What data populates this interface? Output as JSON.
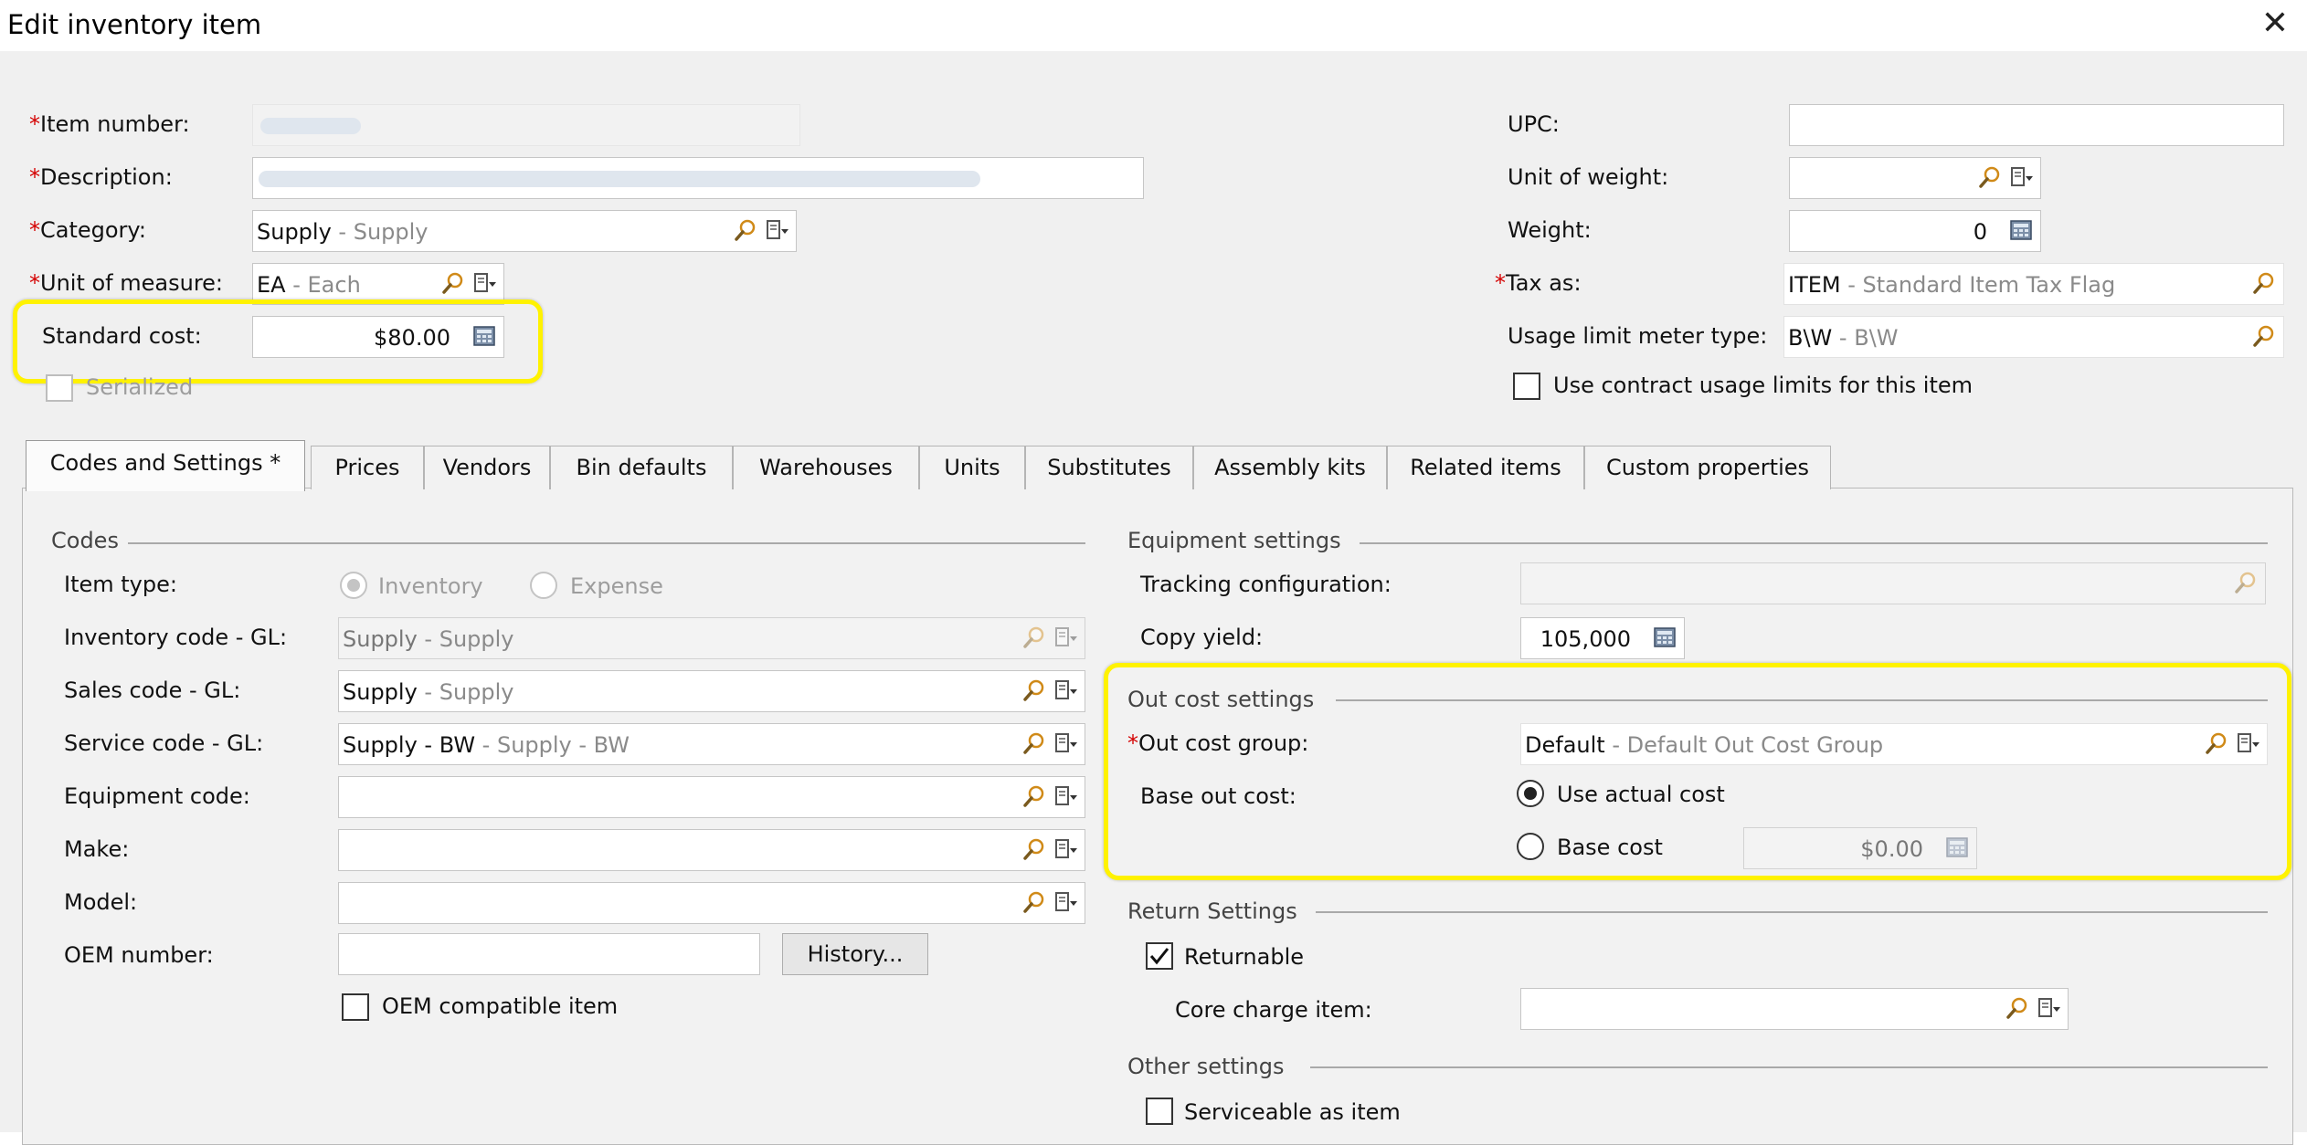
{
  "window": {
    "title": "Edit inventory item",
    "close": "✕"
  },
  "form": {
    "item_number": {
      "label": "Item number:",
      "required": "*"
    },
    "description": {
      "label": "Description:",
      "required": "*"
    },
    "category": {
      "label": "Category:",
      "required": "*",
      "code": "Supply",
      "desc": " - Supply"
    },
    "unit_of_measure": {
      "label": "Unit of measure:",
      "required": "*",
      "code": "EA",
      "desc": " - Each"
    },
    "standard_cost": {
      "label": "Standard cost:",
      "value": "$80.00"
    },
    "serialized": {
      "label": "Serialized",
      "checked": false
    },
    "upc": {
      "label": "UPC:",
      "value": ""
    },
    "unit_of_weight": {
      "label": "Unit of weight:",
      "value": ""
    },
    "weight": {
      "label": "Weight:",
      "value": "0"
    },
    "tax_as": {
      "label": "Tax as:",
      "required": "*",
      "code": "ITEM",
      "desc": " - Standard Item Tax Flag"
    },
    "usage_limit_meter_type": {
      "label": "Usage limit meter type:",
      "code": "B\\W",
      "desc": " - B\\W"
    },
    "use_contract_usage": {
      "label": "Use contract usage limits for this item",
      "checked": false
    }
  },
  "tabs": [
    {
      "label": "Codes and Settings  *",
      "active": true
    },
    {
      "label": "Prices"
    },
    {
      "label": "Vendors"
    },
    {
      "label": "Bin defaults"
    },
    {
      "label": "Warehouses"
    },
    {
      "label": "Units"
    },
    {
      "label": "Substitutes"
    },
    {
      "label": "Assembly kits"
    },
    {
      "label": "Related items"
    },
    {
      "label": "Custom properties"
    }
  ],
  "codes": {
    "title": "Codes",
    "item_type": {
      "label": "Item type:",
      "options": [
        "Inventory",
        "Expense"
      ],
      "selected": "Inventory"
    },
    "inventory_code": {
      "label": "Inventory code - GL:",
      "code": "Supply",
      "desc": " - Supply"
    },
    "sales_code": {
      "label": "Sales code - GL:",
      "code": "Supply",
      "desc": " - Supply"
    },
    "service_code": {
      "label": "Service code - GL:",
      "code": "Supply - BW",
      "desc": " - Supply - BW"
    },
    "equipment_code": {
      "label": "Equipment code:",
      "value": ""
    },
    "make": {
      "label": "Make:",
      "value": ""
    },
    "model": {
      "label": "Model:",
      "value": ""
    },
    "oem_number": {
      "label": "OEM number:",
      "value": "",
      "history_button": "History..."
    },
    "oem_compatible": {
      "label": "OEM compatible item",
      "checked": false
    }
  },
  "equipment_settings": {
    "title": "Equipment settings",
    "tracking_configuration": {
      "label": "Tracking configuration:",
      "value": ""
    },
    "copy_yield": {
      "label": "Copy yield:",
      "value": "105,000"
    }
  },
  "out_cost_settings": {
    "title": "Out cost settings",
    "out_cost_group": {
      "label": "Out cost group:",
      "required": "*",
      "code": "Default",
      "desc": " - Default Out Cost Group"
    },
    "base_out_cost": {
      "label": "Base out cost:",
      "options": [
        "Use actual cost",
        "Base cost"
      ],
      "selected": "Use actual cost",
      "base_cost_value": "$0.00"
    }
  },
  "return_settings": {
    "title": "Return Settings",
    "returnable": {
      "label": "Returnable",
      "checked": true
    },
    "core_charge_item": {
      "label": "Core charge item:",
      "value": ""
    }
  },
  "other_settings": {
    "title": "Other settings",
    "serviceable_as_item": {
      "label": "Serviceable as item",
      "checked": false
    }
  },
  "colors": {
    "highlight": "#fff200",
    "required": "#d40000",
    "dialog_bg": "#f0f0f0"
  }
}
